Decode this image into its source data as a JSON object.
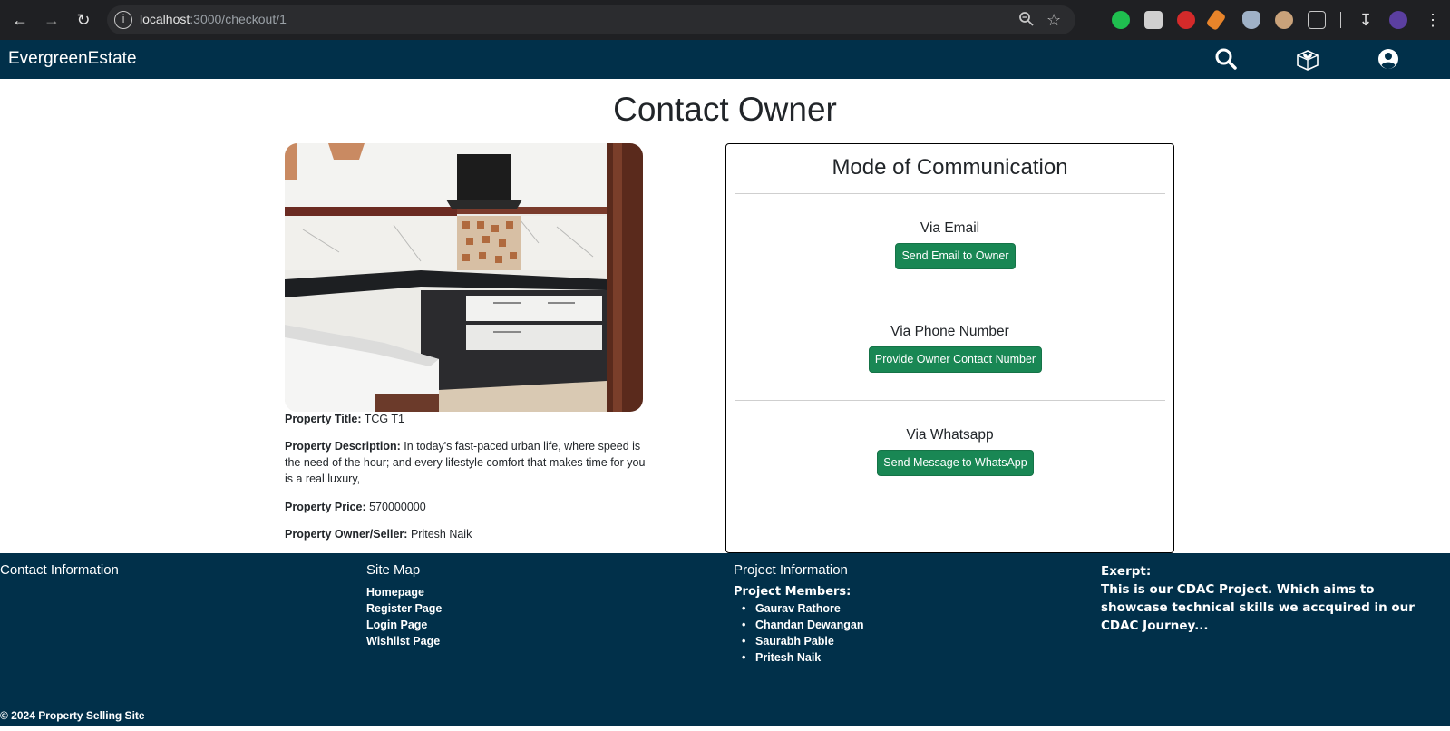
{
  "browser": {
    "url_host": "localhost",
    "url_path": ":3000/checkout/1"
  },
  "navbar": {
    "brand": "EvergreenEstate",
    "icons": [
      "search-icon",
      "wishlist-icon",
      "user-account-icon"
    ]
  },
  "page": {
    "title": "Contact Owner"
  },
  "property": {
    "title_label": "Property Title:",
    "title_value": "TCG T1",
    "description_label": "Property Description:",
    "description_value": "In today's fast-paced urban life, where speed is the need of the hour; and every lifestyle comfort that makes time for you is a real luxury,",
    "price_label": "Property Price:",
    "price_value": "570000000",
    "owner_label": "Property Owner/Seller:",
    "owner_value": "Pritesh Naik"
  },
  "communication": {
    "title": "Mode of Communication",
    "email_label": "Via Email",
    "email_button": "Send Email to Owner",
    "phone_label": "Via Phone Number",
    "phone_button": "Provide Owner Contact Number",
    "whatsapp_label": "Via Whatsapp",
    "whatsapp_button": "Send Message to WhatsApp",
    "button_color": "#198754"
  },
  "footer": {
    "contact_heading": "Contact Information",
    "sitemap_heading": "Site Map",
    "sitemap_links": [
      "Homepage",
      "Register Page",
      "Login Page",
      "Wishlist Page"
    ],
    "project_heading": "Project Information",
    "members_label": "Project Members:",
    "members": [
      "Gaurav Rathore",
      "Chandan Dewangan",
      "Saurabh Pable",
      "Pritesh Naik"
    ],
    "exerpt_label": "Exerpt:",
    "exerpt_text": "This is our CDAC Project. Which aims to showcase technical skills we accquired in our CDAC Journey...",
    "copyright": "© 2024 Property Selling Site",
    "background": "#01304a"
  }
}
